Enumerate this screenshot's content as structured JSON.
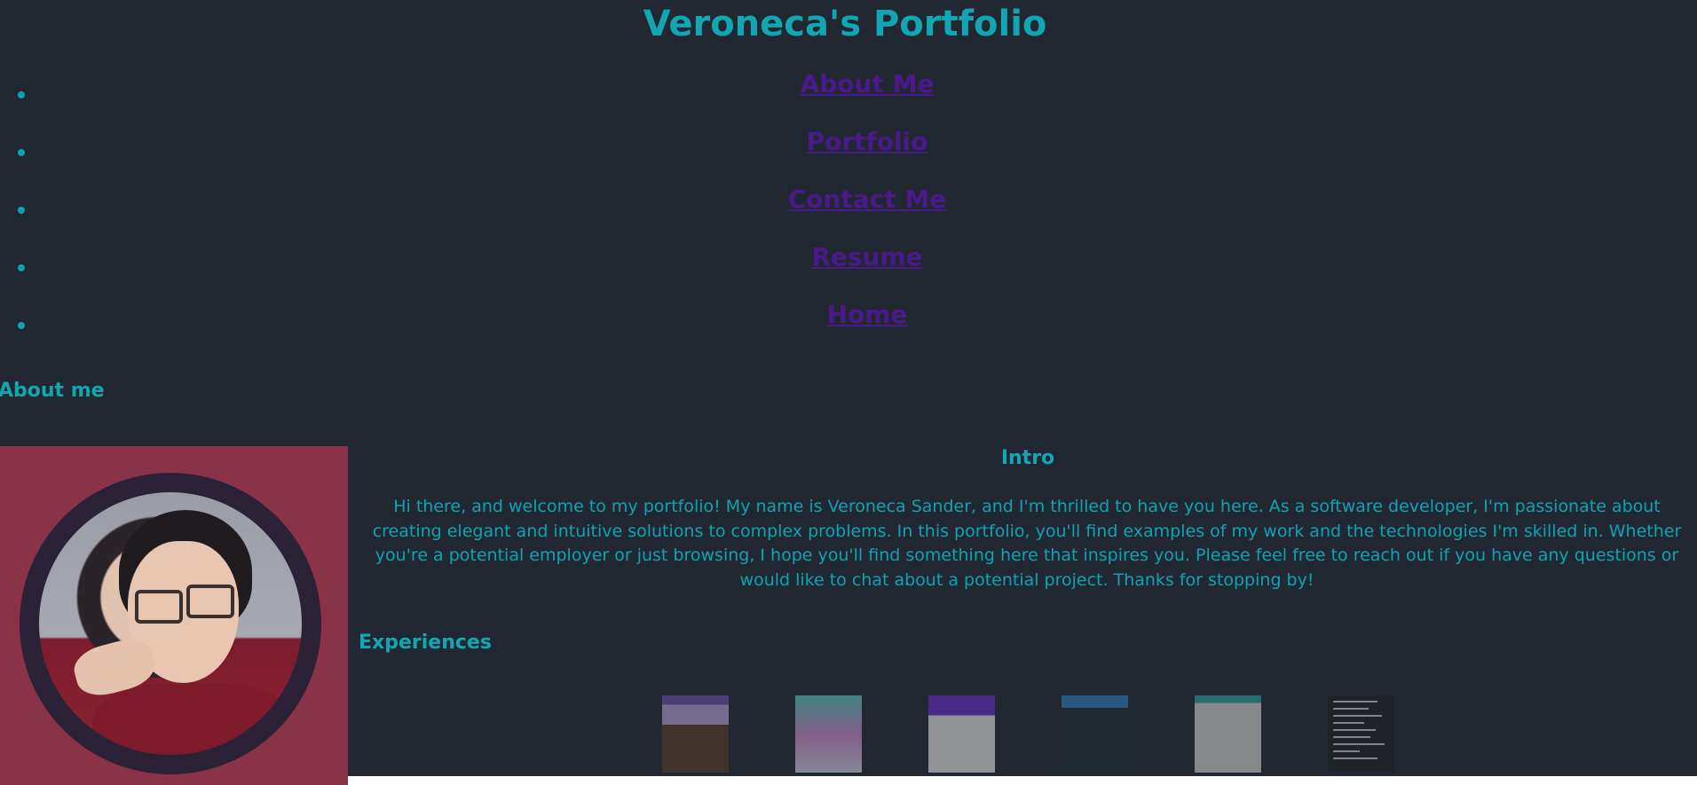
{
  "header": {
    "title": "Veroneca's Portfolio"
  },
  "nav": {
    "items": [
      {
        "label": "About Me"
      },
      {
        "label": "Portfolio"
      },
      {
        "label": "Contact Me"
      },
      {
        "label": "Resume"
      },
      {
        "label": "Home"
      }
    ]
  },
  "about": {
    "heading": "About me",
    "intro_title": "Intro",
    "intro_text": "Hi there, and welcome to my portfolio! My name is Veroneca Sander, and I'm thrilled to have you here. As a software developer, I'm passionate about creating elegant and intuitive solutions to complex problems. In this portfolio, you'll find examples of my work and the technologies I'm skilled in. Whether you're a potential employer or just browsing, I hope you'll find something here that inspires you. Please feel free to reach out if you have any questions or would like to chat about a potential project. Thanks for stopping by!"
  },
  "experiences": {
    "heading": "Experiences"
  },
  "colors": {
    "background": "#222831",
    "accent": "#0fa3b1",
    "link": "#4a1a8c",
    "photo_panel": "#893248"
  }
}
